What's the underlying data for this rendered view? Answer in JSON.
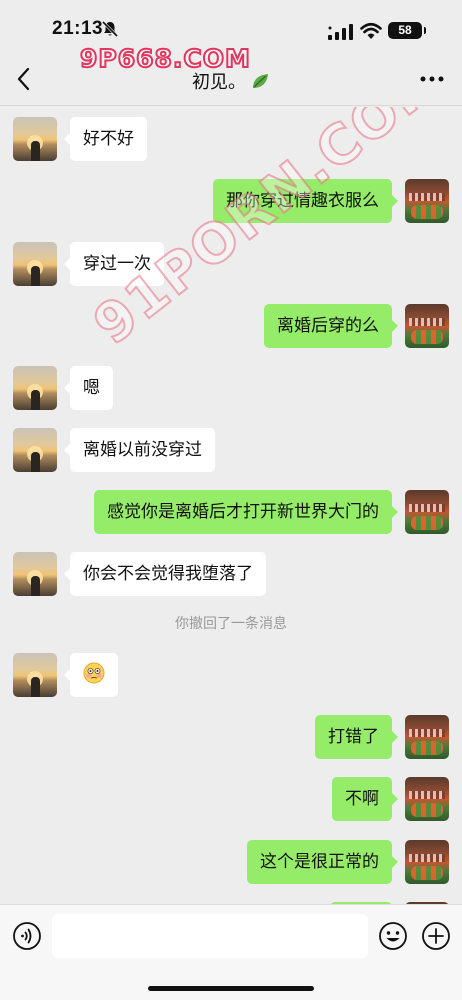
{
  "status_bar": {
    "time": "21:13",
    "battery": "58"
  },
  "watermarks": {
    "top": "9P668.COM",
    "diagonal": "91PORN.COM"
  },
  "nav": {
    "title": "初见。"
  },
  "messages": [
    {
      "side": "left",
      "text": "好不好"
    },
    {
      "side": "right",
      "text": "那你穿过情趣衣服么"
    },
    {
      "side": "left",
      "text": "穿过一次"
    },
    {
      "side": "right",
      "text": "离婚后穿的么"
    },
    {
      "side": "left",
      "text": "嗯"
    },
    {
      "side": "left",
      "text": "离婚以前没穿过"
    },
    {
      "side": "right",
      "text": "感觉你是离婚后才打开新世界大门的"
    },
    {
      "side": "left",
      "text": "你会不会觉得我堕落了"
    },
    {
      "side": "left",
      "emoji": "flushed-face"
    },
    {
      "side": "right",
      "text": "打错了"
    },
    {
      "side": "right",
      "text": "不啊"
    },
    {
      "side": "right",
      "text": "这个是很正常的"
    }
  ],
  "system_notice": "你撤回了一条消息",
  "input": {
    "value": "",
    "placeholder": ""
  },
  "colors": {
    "background": "#ededed",
    "outgoing_bubble": "#95ec69",
    "incoming_bubble": "#ffffff",
    "watermark": "#e0365f"
  }
}
